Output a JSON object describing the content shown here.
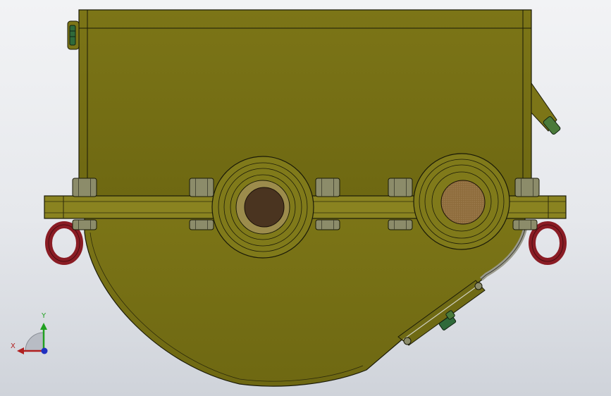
{
  "view": {
    "title": "",
    "background_top": "#f2f3f5",
    "background_bottom": "#cfd3da"
  },
  "model": {
    "housing_color": "#7a7316",
    "housing_edge_color": "#1a1a08",
    "flange_color": "#8a8320",
    "bolt_color": "#8c8c6a",
    "lifting_eye_color": "#8a1c24",
    "left_shaft_color": "#4a3420",
    "right_shaft_color": "#8c6a3a",
    "fitting_color": "#2f6a3a",
    "bolt_count_top": 6,
    "bolt_count_bottom": 6,
    "shaft_count": 2,
    "lifting_eye_count": 2
  },
  "triad": {
    "x_label": "X",
    "y_label": "Y",
    "x_color": "#b02020",
    "y_color": "#20a020",
    "z_color": "#2030c0"
  }
}
